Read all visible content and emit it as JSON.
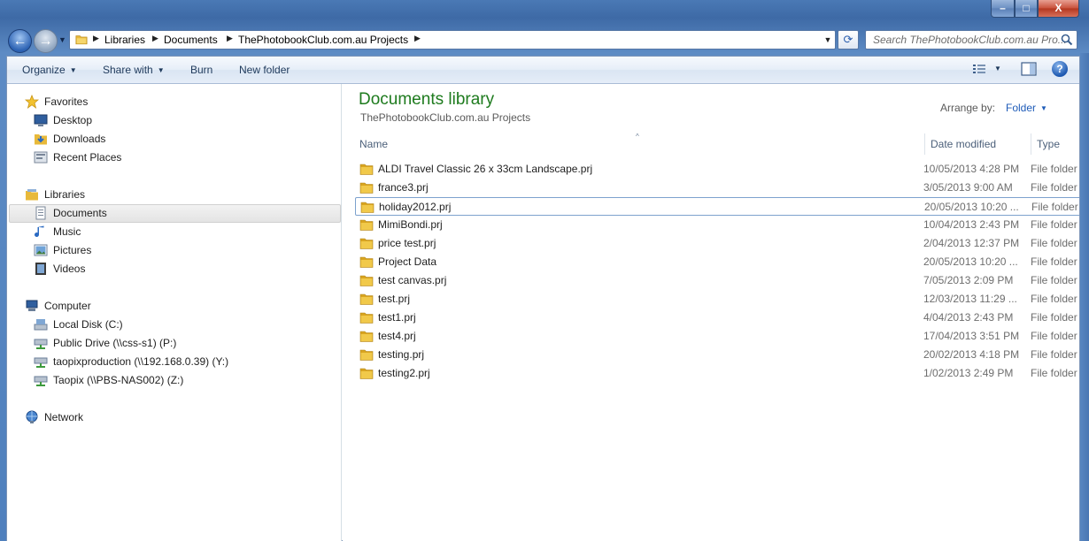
{
  "window": {
    "minimize_glyph": "–",
    "maximize_glyph": "□",
    "close_glyph": "X"
  },
  "nav": {
    "back_glyph": "←",
    "forward_glyph": "→",
    "history_glyph": "▼"
  },
  "address": {
    "crumbs": [
      "Libraries",
      "Documents",
      "ThePhotobookClub.com.au Projects"
    ],
    "separator": "▶",
    "dropdown_glyph": "▼",
    "refresh_glyph": "⟳"
  },
  "search": {
    "placeholder": "Search ThePhotobookClub.com.au Pro..."
  },
  "toolbar": {
    "organize": "Organize",
    "share_with": "Share with",
    "burn": "Burn",
    "new_folder": "New folder",
    "dropdown_glyph": "▼",
    "help_glyph": "?"
  },
  "navpane": {
    "favorites": "Favorites",
    "desktop": "Desktop",
    "downloads": "Downloads",
    "recent_places": "Recent Places",
    "libraries": "Libraries",
    "documents": "Documents",
    "music": "Music",
    "pictures": "Pictures",
    "videos": "Videos",
    "computer": "Computer",
    "local_disk": "Local Disk (C:)",
    "public_drive": "Public Drive (\\\\css-s1) (P:)",
    "taopixproduction": "taopixproduction (\\\\192.168.0.39) (Y:)",
    "taopix": "Taopix (\\\\PBS-NAS002) (Z:)",
    "network": "Network"
  },
  "library": {
    "title": "Documents library",
    "subtitle": "ThePhotobookClub.com.au Projects",
    "arrange_label": "Arrange by:",
    "arrange_value": "Folder"
  },
  "columns": {
    "name": "Name",
    "date_modified": "Date modified",
    "type": "Type",
    "sort_glyph": "^"
  },
  "files": [
    {
      "name": "ALDI Travel Classic 26 x 33cm Landscape.prj",
      "date": "10/05/2013 4:28 PM",
      "type": "File folder"
    },
    {
      "name": "france3.prj",
      "date": "3/05/2013 9:00 AM",
      "type": "File folder"
    },
    {
      "name": "holiday2012.prj",
      "date": "20/05/2013 10:20 ...",
      "type": "File folder"
    },
    {
      "name": "MimiBondi.prj",
      "date": "10/04/2013 2:43 PM",
      "type": "File folder"
    },
    {
      "name": "price test.prj",
      "date": "2/04/2013 12:37 PM",
      "type": "File folder"
    },
    {
      "name": "Project Data",
      "date": "20/05/2013 10:20 ...",
      "type": "File folder"
    },
    {
      "name": "test canvas.prj",
      "date": "7/05/2013 2:09 PM",
      "type": "File folder"
    },
    {
      "name": "test.prj",
      "date": "12/03/2013 11:29 ...",
      "type": "File folder"
    },
    {
      "name": "test1.prj",
      "date": "4/04/2013 2:43 PM",
      "type": "File folder"
    },
    {
      "name": "test4.prj",
      "date": "17/04/2013 3:51 PM",
      "type": "File folder"
    },
    {
      "name": "testing.prj",
      "date": "20/02/2013 4:18 PM",
      "type": "File folder"
    },
    {
      "name": "testing2.prj",
      "date": "1/02/2013 2:49 PM",
      "type": "File folder"
    }
  ],
  "selected_index": 2,
  "colors": {
    "title_green": "#1e7b1e",
    "link_blue": "#1e5bb8",
    "folder_yellow": "#e8b93a"
  }
}
